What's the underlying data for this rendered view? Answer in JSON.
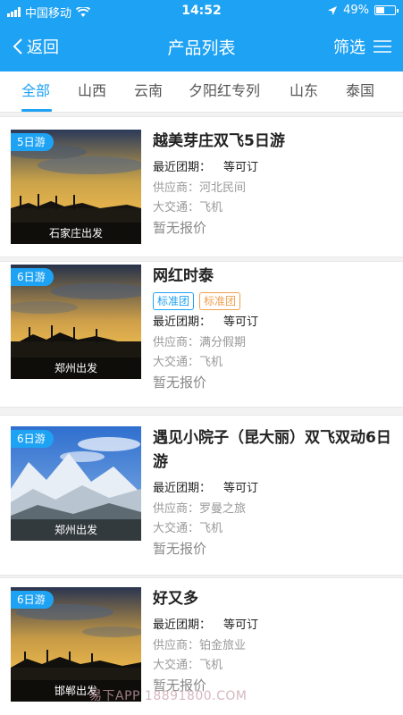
{
  "status": {
    "carrier": "中国移动",
    "time": "14:52",
    "battery": "49%",
    "battery_level": 0.49
  },
  "nav": {
    "back": "返回",
    "title": "产品列表",
    "filter": "筛选"
  },
  "tabs": [
    "全部",
    "山西",
    "云南",
    "夕阳红专列",
    "山东",
    "泰国"
  ],
  "active_tab": "全部",
  "labels": {
    "latest": "最近团期：",
    "supplier": "供应商：",
    "transport": "大交通："
  },
  "products": [
    {
      "days": "5日游",
      "depart": "石家庄出发",
      "title": "越美芽庄双飞5日游",
      "tags": [],
      "latest": "等可订",
      "supplier": "河北民间",
      "transport": "飞机",
      "price": "暂无报价"
    },
    {
      "days": "6日游",
      "depart": "郑州出发",
      "title": "网红时泰",
      "tags": [
        "标准团",
        "标准团"
      ],
      "latest": "等可订",
      "supplier": "满分假期",
      "transport": "飞机",
      "price": "暂无报价"
    },
    {
      "days": "6日游",
      "depart": "郑州出发",
      "title": "遇见小院子（昆大丽）双飞双动6日游",
      "tags": [],
      "latest": "等可订",
      "supplier": "罗曼之旅",
      "transport": "飞机",
      "price": "暂无报价"
    },
    {
      "days": "6日游",
      "depart": "邯郸出发",
      "title": "好又多",
      "tags": [],
      "latest": "等可订",
      "supplier": "铂金旅业",
      "transport": "飞机",
      "price": "暂无报价"
    }
  ],
  "watermark": "易下APP 18891800.COM",
  "colors": {
    "accent": "#1ea2f3",
    "tag_orange": "#f0a050"
  }
}
